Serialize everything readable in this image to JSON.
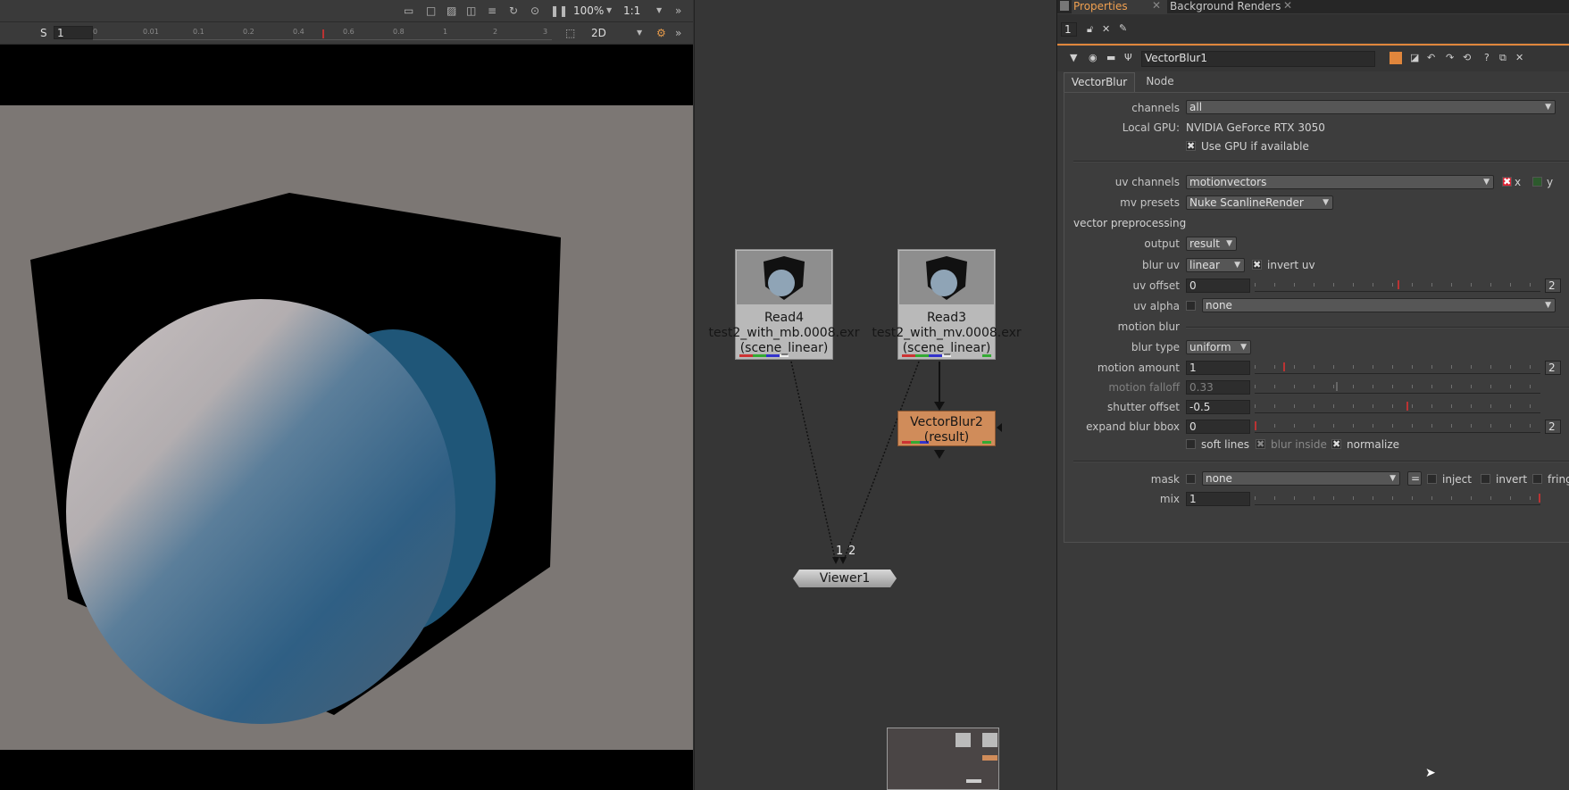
{
  "viewer": {
    "zoom": "100%",
    "ratio": "1:1",
    "frame_prefix": "S",
    "frame_value": "1",
    "view_mode": "2D",
    "ruler_ticks": [
      "0",
      "0.01",
      "0.1",
      "0.2",
      "0.4",
      "0.6",
      "0.8",
      "1",
      "2",
      "3"
    ]
  },
  "node_graph": {
    "read4": {
      "name": "Read4",
      "file": "test2_with_mb.0008.exr",
      "colorspace": "(scene_linear)"
    },
    "read3": {
      "name": "Read3",
      "file": "test2_with_mv.0008.exr",
      "colorspace": "(scene_linear)"
    },
    "vectorblur2": {
      "name": "VectorBlur2",
      "output": "(result)"
    },
    "viewer1": {
      "name": "Viewer1",
      "input1": "1",
      "input2": "2"
    },
    "colors": {
      "vectorblur_node": "#d08c5a",
      "read_node": "#b9b9b9"
    }
  },
  "properties": {
    "tabs": [
      "Properties",
      "Background Renders"
    ],
    "max_panels": "1",
    "node_name": "VectorBlur1",
    "subtabs": [
      "VectorBlur",
      "Node"
    ],
    "channels": {
      "label": "channels",
      "value": "all"
    },
    "local_gpu": {
      "label": "Local GPU:",
      "value": "NVIDIA GeForce RTX 3050"
    },
    "use_gpu": {
      "label": "Use GPU if available",
      "checked": true
    },
    "uv_channels": {
      "label": "uv channels",
      "value": "motionvectors",
      "x_label": "x",
      "y_label": "y"
    },
    "mv_presets": {
      "label": "mv presets",
      "value": "Nuke ScanlineRender"
    },
    "vector_preprocessing": "vector preprocessing",
    "output": {
      "label": "output",
      "value": "result"
    },
    "blur_uv": {
      "label": "blur uv",
      "value": "linear",
      "invert_label": "invert uv"
    },
    "uv_offset": {
      "label": "uv offset",
      "value": "0",
      "ticks": [
        "-1",
        "-0.8",
        "-0.6",
        "-0.4",
        "-0.2",
        "0",
        "0.2",
        "0.4",
        "0.6",
        "0.8",
        "1"
      ],
      "views": "2"
    },
    "uv_alpha": {
      "label": "uv alpha",
      "value": "none"
    },
    "motion_blur": "motion blur",
    "blur_type": {
      "label": "blur type",
      "value": "uniform"
    },
    "motion_amount": {
      "label": "motion amount",
      "value": "1",
      "ticks": [
        "0",
        "1",
        "5",
        "10",
        "20",
        "30",
        "40",
        "50",
        "60",
        "70",
        "80",
        "90",
        "100"
      ],
      "views": "2"
    },
    "motion_falloff": {
      "label": "motion falloff",
      "value": "0.33",
      "ticks": [
        "0.01",
        "0.1",
        "0.2",
        "0.3",
        "0.4",
        "0.5",
        "0.6",
        "0.7",
        "0.8",
        "0.9",
        "1"
      ]
    },
    "shutter_offset": {
      "label": "shutter offset",
      "value": "-0.5",
      "ticks": [
        "-1",
        "-0.9",
        "-0.8",
        "-0.7",
        "-0.6",
        "-0.5",
        "-0.4",
        "-0.3",
        "-0.2",
        "-0.1",
        "0"
      ]
    },
    "expand_blur_bbox": {
      "label": "expand blur bbox",
      "value": "0",
      "ticks": [
        "0",
        "1",
        "5",
        "10",
        "20",
        "30",
        "40",
        "50",
        "60",
        "70",
        "80",
        "90",
        "100"
      ],
      "views": "2"
    },
    "soft_lines": "soft lines",
    "blur_inside": "blur inside",
    "normalize": "normalize",
    "mask": {
      "label": "mask",
      "value": "none",
      "eq": "=",
      "inject": "inject",
      "invert": "invert",
      "fringe": "fring"
    },
    "mix": {
      "label": "mix",
      "value": "1",
      "ticks": [
        "0",
        "0.1",
        "0.2",
        "0.3",
        "0.4",
        "0.5",
        "0.6",
        "0.7",
        "0.8",
        "0.9",
        "1"
      ]
    },
    "colors": {
      "accent": "#f0a050"
    }
  }
}
